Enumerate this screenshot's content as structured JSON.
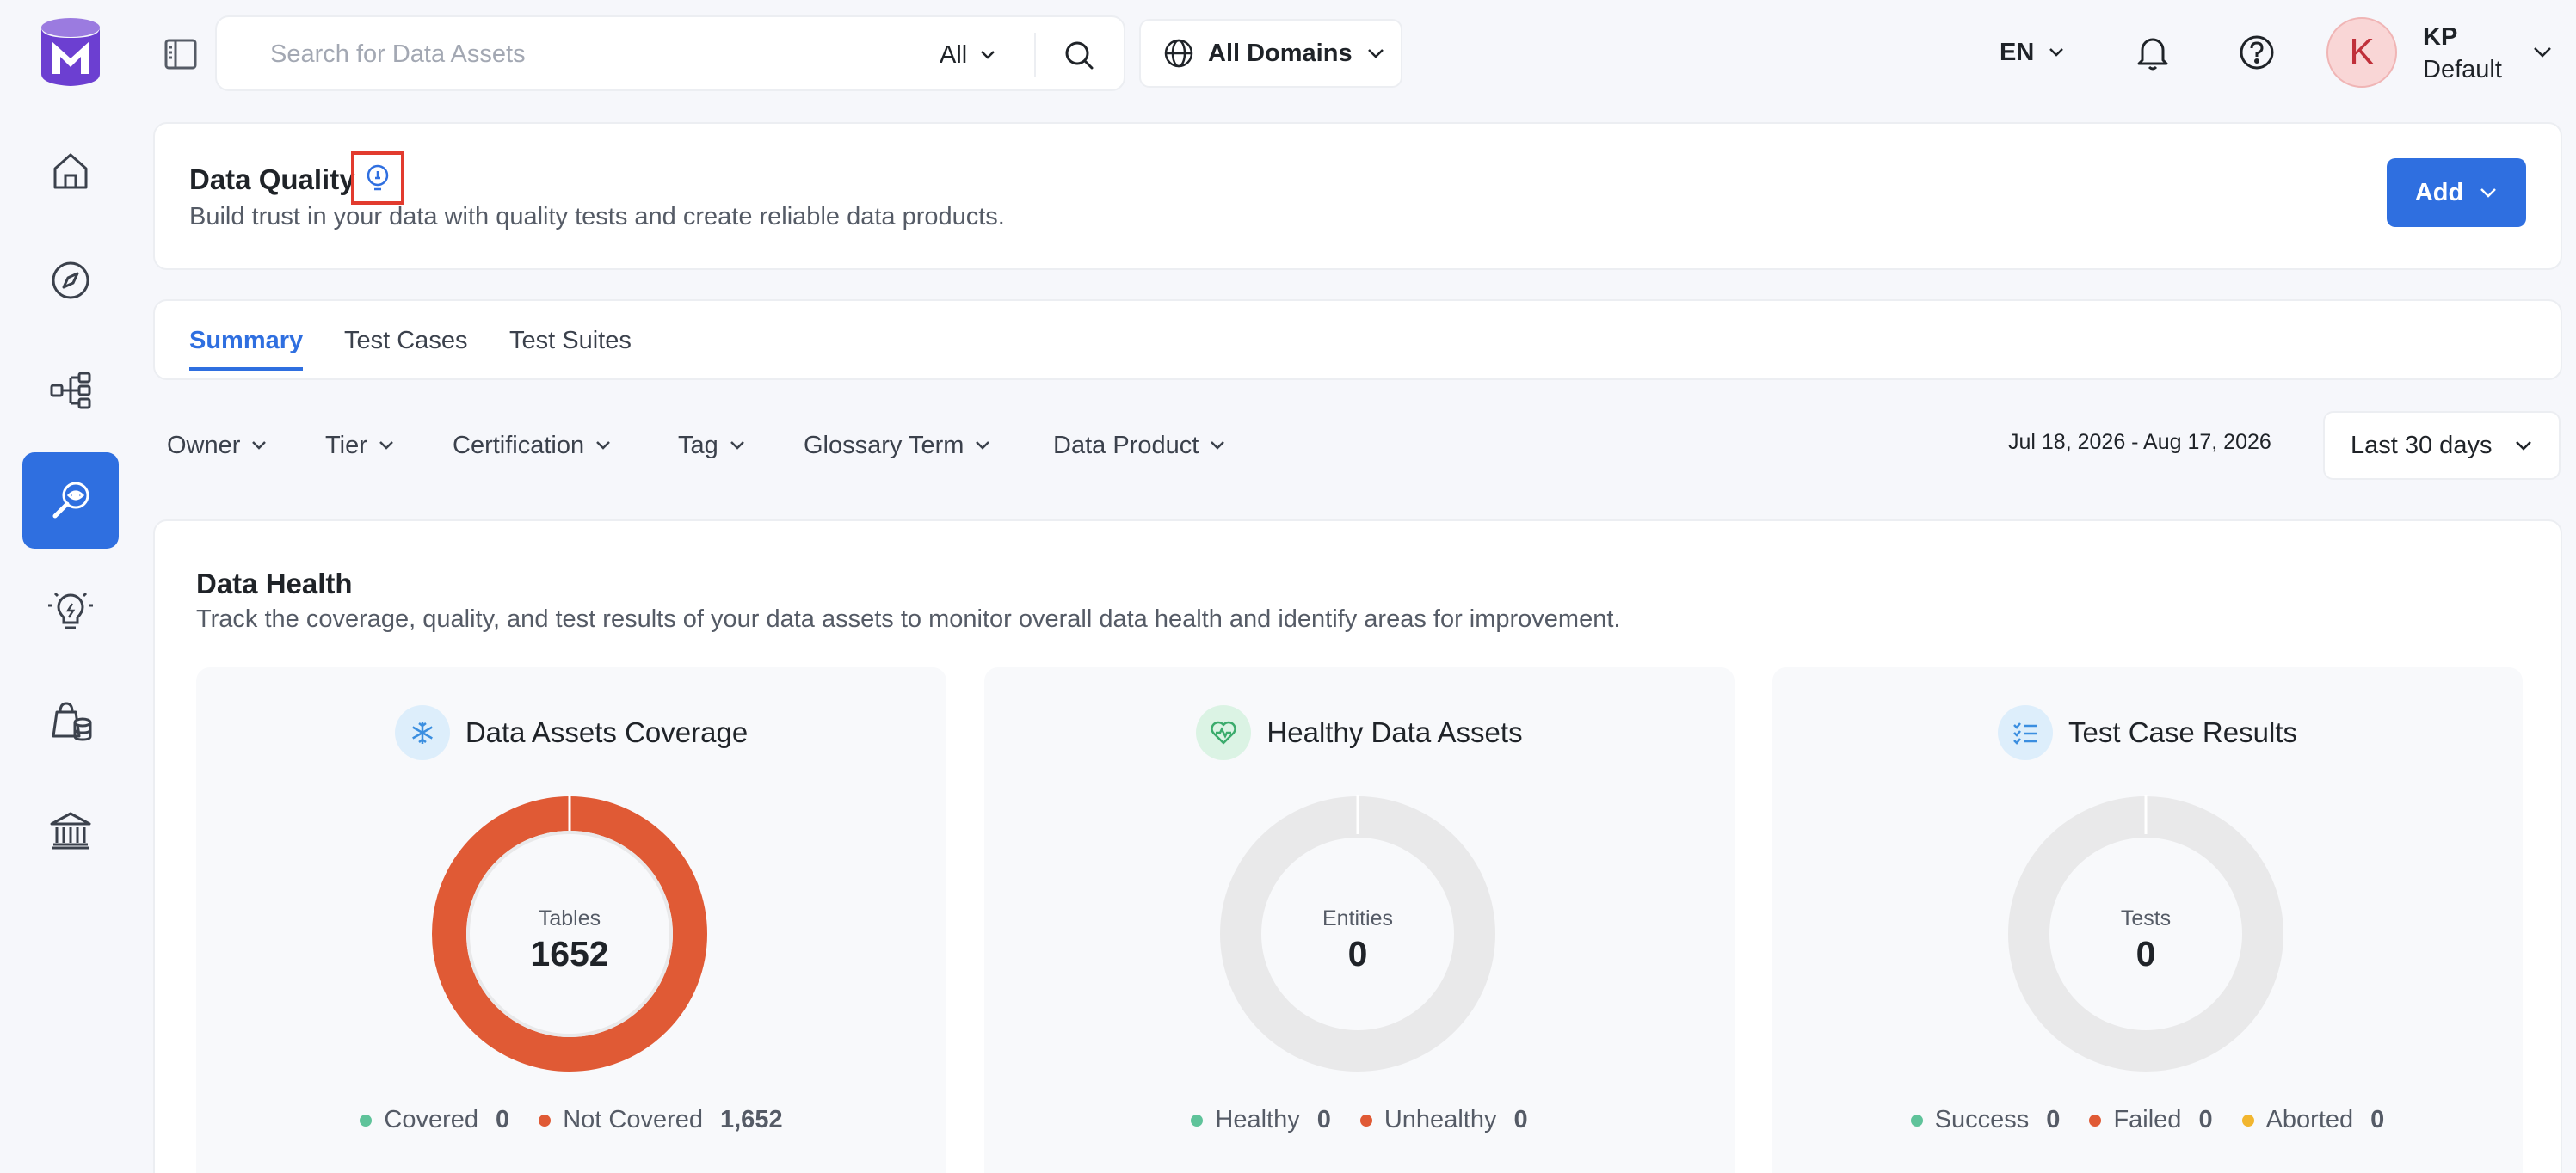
{
  "colors": {
    "primary": "#2f6fe0",
    "covered": "#5fc39a",
    "not_covered": "#e05a35",
    "aborted": "#f2b62f",
    "empty_ring": "#e9e9ea",
    "highlight": "#e23b2e"
  },
  "sidebar": {
    "items": [
      {
        "name": "home",
        "icon": "home-icon"
      },
      {
        "name": "explore",
        "icon": "compass-icon"
      },
      {
        "name": "lineage",
        "icon": "lineage-icon"
      },
      {
        "name": "observability",
        "icon": "data-quality-icon",
        "active": true
      },
      {
        "name": "insights",
        "icon": "lightbulb-icon"
      },
      {
        "name": "domains",
        "icon": "database-bag-icon"
      },
      {
        "name": "governance",
        "icon": "bank-icon"
      }
    ]
  },
  "topbar": {
    "search_placeholder": "Search for Data Assets",
    "search_scope": "All",
    "domains_label": "All Domains",
    "language": "EN",
    "avatar_initial": "K",
    "user_name": "KP",
    "user_role": "Default"
  },
  "header": {
    "title": "Data Quality",
    "description": "Build trust in your data with quality tests and create reliable data products.",
    "add_label": "Add"
  },
  "tabs": [
    {
      "label": "Summary",
      "active": true
    },
    {
      "label": "Test Cases",
      "active": false
    },
    {
      "label": "Test Suites",
      "active": false
    }
  ],
  "filters": [
    {
      "label": "Owner"
    },
    {
      "label": "Tier"
    },
    {
      "label": "Certification"
    },
    {
      "label": "Tag"
    },
    {
      "label": "Glossary Term"
    },
    {
      "label": "Data Product"
    }
  ],
  "date_range": "Jul 18, 2026 - Aug 17, 2026",
  "period": "Last 30 days",
  "data_health": {
    "title": "Data Health",
    "description": "Track the coverage, quality, and test results of your data assets to monitor overall data health and identify areas for improvement.",
    "cards": [
      {
        "title": "Data Assets Coverage",
        "icon": "snowflake-icon",
        "center_label": "Tables",
        "center_value": "1652",
        "legend": [
          {
            "label": "Covered",
            "value": "0"
          },
          {
            "label": "Not Covered",
            "value": "1,652"
          }
        ]
      },
      {
        "title": "Healthy Data Assets",
        "icon": "heart-pulse-icon",
        "center_label": "Entities",
        "center_value": "0",
        "legend": [
          {
            "label": "Healthy",
            "value": "0"
          },
          {
            "label": "Unhealthy",
            "value": "0"
          }
        ]
      },
      {
        "title": "Test Case Results",
        "icon": "checklist-icon",
        "center_label": "Tests",
        "center_value": "0",
        "legend": [
          {
            "label": "Success",
            "value": "0"
          },
          {
            "label": "Failed",
            "value": "0"
          },
          {
            "label": "Aborted",
            "value": "0"
          }
        ]
      }
    ]
  }
}
